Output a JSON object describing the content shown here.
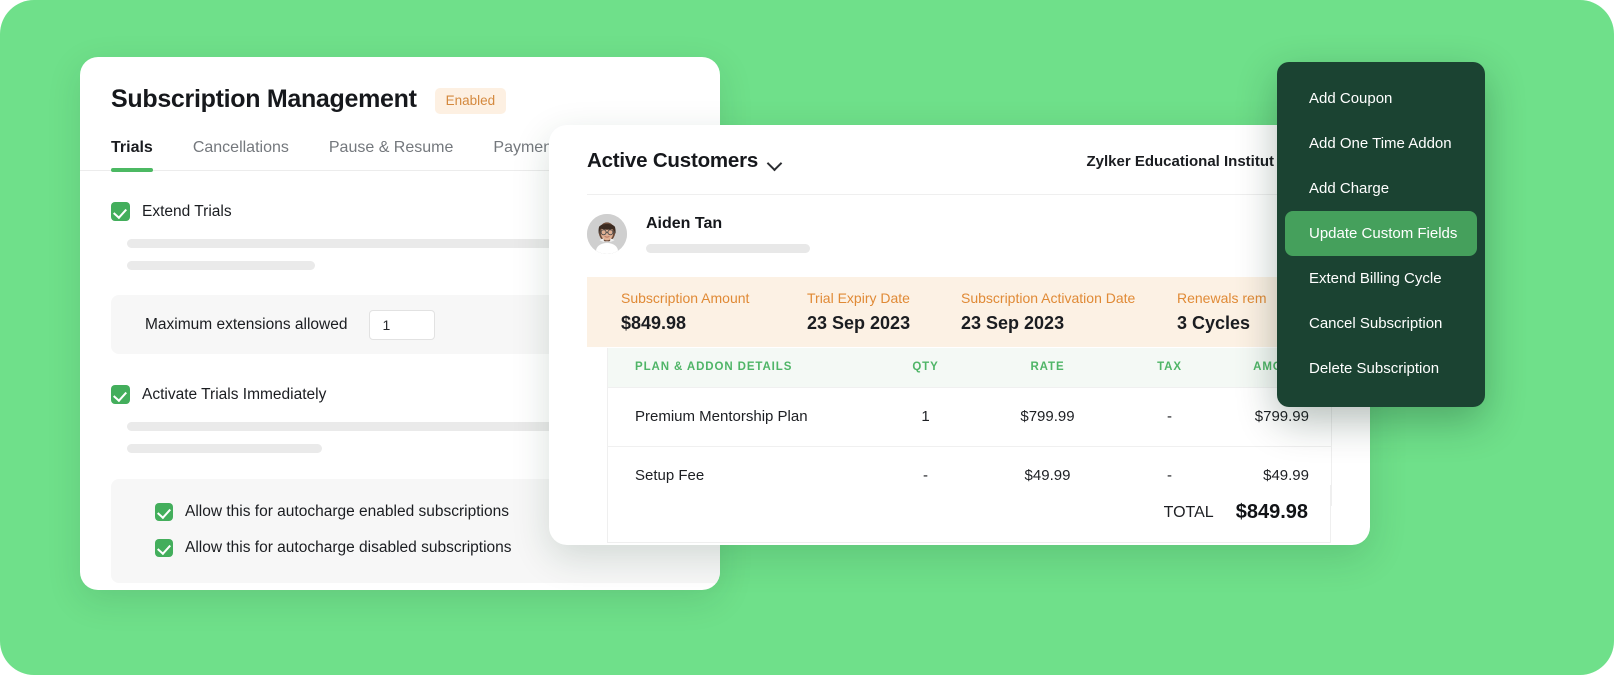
{
  "theme": {
    "background": "#6FE08A",
    "accent_green": "#4CB963",
    "check_green": "#43AE5C",
    "menu_dark": "#1B4332",
    "menu_highlight": "#45A05C",
    "badge_bg": "#FDF0E2",
    "badge_text": "#D4893E",
    "summary_bg": "#FCF1E4",
    "summary_label": "#E08A36",
    "table_header_bg": "#F4F9F5",
    "table_header_text": "#4FB567"
  },
  "settings_card": {
    "title": "Subscription Management",
    "badge": "Enabled",
    "tabs": [
      {
        "label": "Trials",
        "active": true
      },
      {
        "label": "Cancellations",
        "active": false
      },
      {
        "label": "Pause & Resume",
        "active": false
      },
      {
        "label": "Payments",
        "active": false
      }
    ],
    "extend_trials": {
      "label": "Extend Trials",
      "checked": true
    },
    "max_extensions": {
      "label": "Maximum extensions allowed",
      "value": "1",
      "placeholder": "1"
    },
    "activate_trials": {
      "label": "Activate Trials Immediately",
      "checked": true
    },
    "autocharge_options": [
      {
        "label": "Allow this for autocharge enabled subscriptions",
        "checked": true
      },
      {
        "label": "Allow this for autocharge disabled subscriptions",
        "checked": true
      }
    ]
  },
  "customer_card": {
    "title": "Active Customers",
    "caret_icon": "chevron-down-icon",
    "organization": "Zylker Educational Institut",
    "person": {
      "name": "Aiden Tan",
      "avatar_icon": "avatar"
    },
    "summary": [
      {
        "label": "Subscription Amount",
        "value": "$849.98"
      },
      {
        "label": "Trial Expiry Date",
        "value": "23 Sep 2023"
      },
      {
        "label": "Subscription Activation Date",
        "value": "23 Sep 2023"
      },
      {
        "label": "Renewals rem",
        "value": "3 Cycles"
      }
    ],
    "table": {
      "columns": [
        "PLAN & ADDON DETAILS",
        "QTY",
        "RATE",
        "TAX",
        "AMOUNT"
      ],
      "rows": [
        {
          "name": "Premium Mentorship Plan",
          "qty": "1",
          "rate": "$799.99",
          "tax": "-",
          "amount": "$799.99"
        },
        {
          "name": "Setup Fee",
          "qty": "-",
          "rate": "$49.99",
          "tax": "-",
          "amount": "$49.99"
        }
      ],
      "total_label": "TOTAL",
      "total_value": "$849.98"
    }
  },
  "context_menu": {
    "items": [
      {
        "label": "Add Coupon",
        "highlight": false
      },
      {
        "label": "Add One Time Addon",
        "highlight": false
      },
      {
        "label": "Add Charge",
        "highlight": false
      },
      {
        "label": "Update Custom Fields",
        "highlight": true
      },
      {
        "label": "Extend Billing Cycle",
        "highlight": false
      },
      {
        "label": "Cancel Subscription",
        "highlight": false
      },
      {
        "label": "Delete Subscription",
        "highlight": false
      }
    ]
  }
}
